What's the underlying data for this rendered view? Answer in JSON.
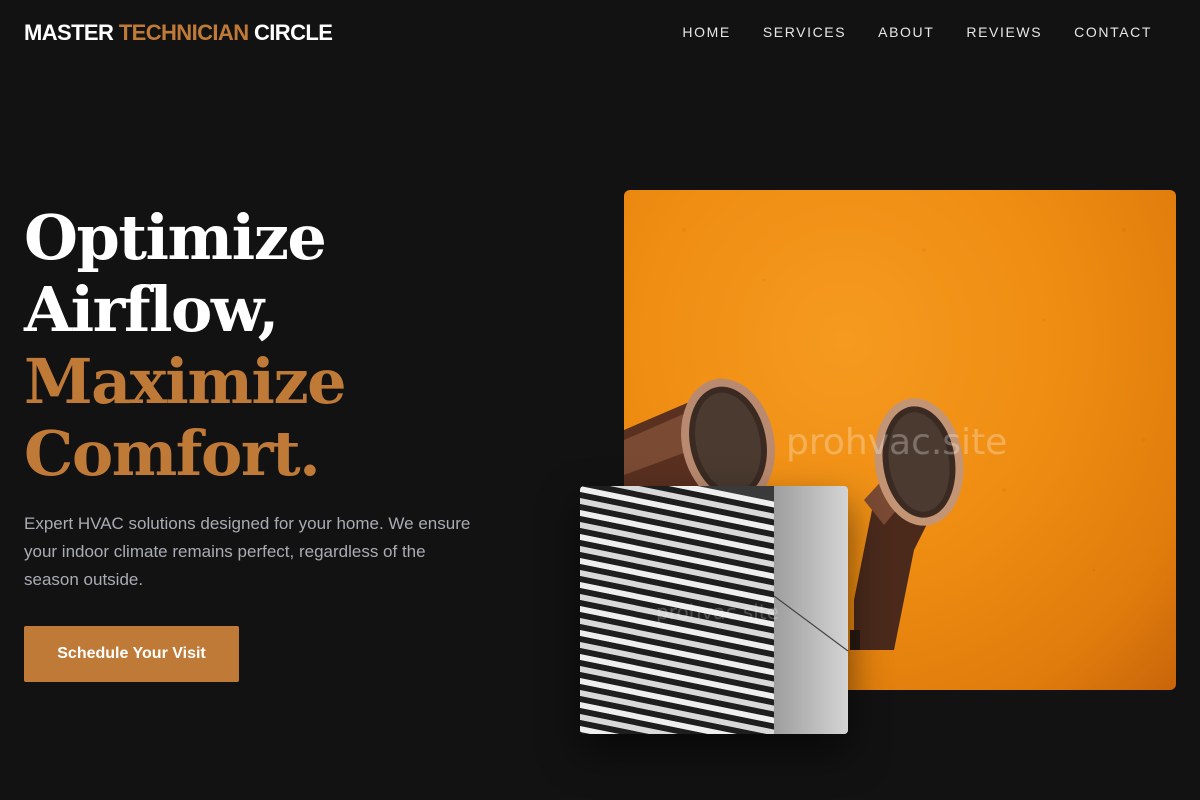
{
  "header": {
    "logo": {
      "part1": "MASTER ",
      "part2": "TECHNICIAN",
      "part3": " CIRCLE"
    },
    "nav": [
      "HOME",
      "SERVICES",
      "ABOUT",
      "REVIEWS",
      "CONTACT"
    ]
  },
  "hero": {
    "title_line1": "Optimize",
    "title_line2": "Airflow,",
    "title_line3": "Maximize",
    "title_line4": "Comfort.",
    "description": "Expert HVAC solutions designed for your home. We ensure your indoor climate remains perfect, regardless of the season outside.",
    "cta_label": "Schedule Your Visit"
  },
  "images": {
    "main_watermark": "prohvac.site",
    "small_watermark": "prohvac.site"
  },
  "colors": {
    "background": "#121212",
    "accent": "#c07a38",
    "text_muted": "#a9acb3"
  }
}
